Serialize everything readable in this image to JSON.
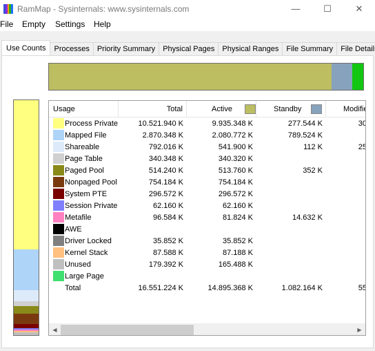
{
  "window": {
    "title": "RamMap - Sysinternals: www.sysinternals.com",
    "icon_colors": [
      "#3a50d8",
      "#8a2be2",
      "#ff9900",
      "#22b022",
      "#2070ff"
    ],
    "minimize_glyph": "—",
    "maximize_glyph": "☐",
    "close_glyph": "✕"
  },
  "menu": [
    "File",
    "Empty",
    "Settings",
    "Help"
  ],
  "tabs": [
    "Use Counts",
    "Processes",
    "Priority Summary",
    "Physical Pages",
    "Physical Ranges",
    "File Summary",
    "File Details"
  ],
  "active_tab": 0,
  "top_bar_colors": [
    "#bdbd62",
    "#87a2bd",
    "#12c612"
  ],
  "columns": {
    "usage": "Usage",
    "total": "Total",
    "active": "Active",
    "standby": "Standby",
    "modified": "Modifie",
    "active_color": "#bdbd62",
    "standby_color": "#87a2bd"
  },
  "rows": [
    {
      "label": "Process Private",
      "color": "#ffff80",
      "total": "10.521.940 K",
      "active": "9.935.348 K",
      "standby": "277.544 K",
      "modified": "30"
    },
    {
      "label": "Mapped File",
      "color": "#aed4f8",
      "total": "2.870.348 K",
      "active": "2.080.772 K",
      "standby": "789.524 K",
      "modified": ""
    },
    {
      "label": "Shareable",
      "color": "#ddeafa",
      "total": "792.016 K",
      "active": "541.900 K",
      "standby": "112 K",
      "modified": "25"
    },
    {
      "label": "Page Table",
      "color": "#d0d0d0",
      "total": "340.348 K",
      "active": "340.320 K",
      "standby": "",
      "modified": ""
    },
    {
      "label": "Paged Pool",
      "color": "#8a8a1a",
      "total": "514.240 K",
      "active": "513.760 K",
      "standby": "352 K",
      "modified": ""
    },
    {
      "label": "Nonpaged Pool",
      "color": "#7a3a10",
      "total": "754.184 K",
      "active": "754.184 K",
      "standby": "",
      "modified": ""
    },
    {
      "label": "System PTE",
      "color": "#7a0000",
      "total": "296.572 K",
      "active": "296.572 K",
      "standby": "",
      "modified": ""
    },
    {
      "label": "Session Private",
      "color": "#8080ff",
      "total": "62.160 K",
      "active": "62.160 K",
      "standby": "",
      "modified": ""
    },
    {
      "label": "Metafile",
      "color": "#ff80c0",
      "total": "96.584 K",
      "active": "81.824 K",
      "standby": "14.632 K",
      "modified": ""
    },
    {
      "label": "AWE",
      "color": "#000000",
      "total": "",
      "active": "",
      "standby": "",
      "modified": ""
    },
    {
      "label": "Driver Locked",
      "color": "#808080",
      "total": "35.852 K",
      "active": "35.852 K",
      "standby": "",
      "modified": ""
    },
    {
      "label": "Kernel Stack",
      "color": "#ffc080",
      "total": "87.588 K",
      "active": "87.188 K",
      "standby": "",
      "modified": ""
    },
    {
      "label": "Unused",
      "color": "#c0c0c0",
      "total": "179.392 K",
      "active": "165.488 K",
      "standby": "",
      "modified": ""
    },
    {
      "label": "Large Page",
      "color": "#40e070",
      "total": "",
      "active": "",
      "standby": "",
      "modified": ""
    },
    {
      "label": "Total",
      "color": "",
      "total": "16.551.224 K",
      "active": "14.895.368 K",
      "standby": "1.082.164 K",
      "modified": "55"
    }
  ]
}
